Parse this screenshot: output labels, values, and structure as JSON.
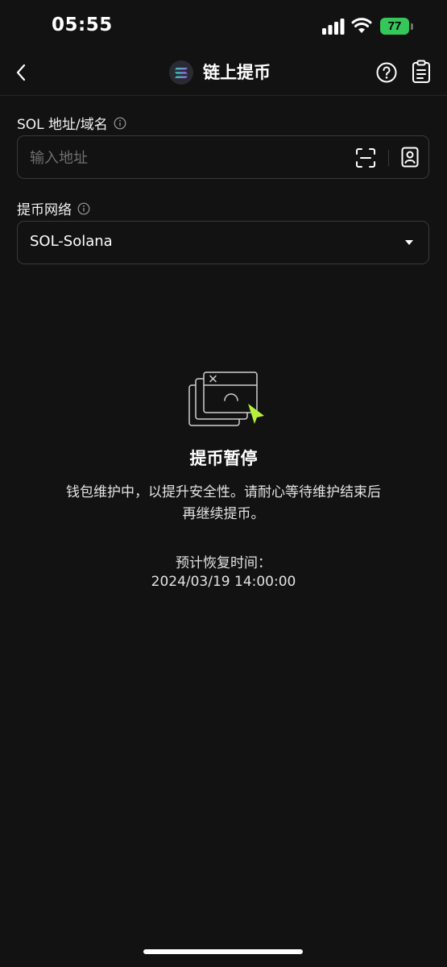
{
  "status_bar": {
    "time": "05:55",
    "battery": "77",
    "battery_color": "#35c759"
  },
  "header": {
    "title": "链上提币",
    "back_icon": "chevron-left-icon",
    "coin_icon": "solana-logo-icon",
    "help_icon": "question-circle-icon",
    "records_icon": "clipboard-icon"
  },
  "address_field": {
    "label": "SOL 地址/域名",
    "placeholder": "输入地址",
    "value": "",
    "scan_icon": "scan-icon",
    "address_book_icon": "contact-book-icon"
  },
  "network_field": {
    "label": "提币网络",
    "value": "SOL-Solana"
  },
  "maintenance": {
    "title": "提币暂停",
    "description": "钱包维护中，以提升安全性。请耐心等待维护结束后再继续提币。",
    "eta_label": "预计恢复时间：",
    "eta_value": "2024/03/19 14:00:00",
    "accent_color": "#b6f23c"
  }
}
